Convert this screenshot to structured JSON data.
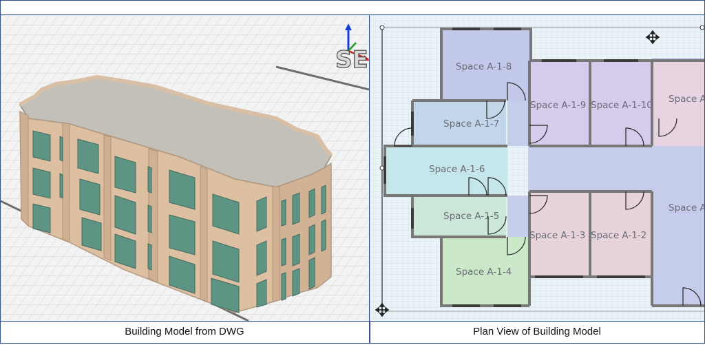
{
  "left_panel": {
    "caption": "Building Model from DWG",
    "view_cube_label": "SE"
  },
  "right_panel": {
    "caption": "Plan View of Building Model",
    "rooms": [
      {
        "id": "a18",
        "label": "Space A-1-8"
      },
      {
        "id": "a19",
        "label": "Space A-1-9"
      },
      {
        "id": "a110",
        "label": "Space A-1-10"
      },
      {
        "id": "a1r",
        "label": "Space A"
      },
      {
        "id": "a17",
        "label": "Space A-1-7"
      },
      {
        "id": "a16",
        "label": "Space A-1-6"
      },
      {
        "id": "a15",
        "label": "Space A-1-5"
      },
      {
        "id": "a14",
        "label": "Space A-1-4"
      },
      {
        "id": "a13",
        "label": "Space A-1-3"
      },
      {
        "id": "a12",
        "label": "Space A-1-2"
      },
      {
        "id": "a1c",
        "label": "Space A"
      }
    ],
    "colors": {
      "corridor": "#c6cdea",
      "a18": "#c3c9ea",
      "a19": "#d6cbea",
      "a110": "#d6cbea",
      "a1r": "#e8d4e0",
      "a17": "#c2d6ea",
      "a16": "#c5e6ea",
      "a15": "#cbe7d8",
      "a14": "#cbe8c8",
      "a13": "#e6d4da",
      "a12": "#e6d4da"
    }
  }
}
